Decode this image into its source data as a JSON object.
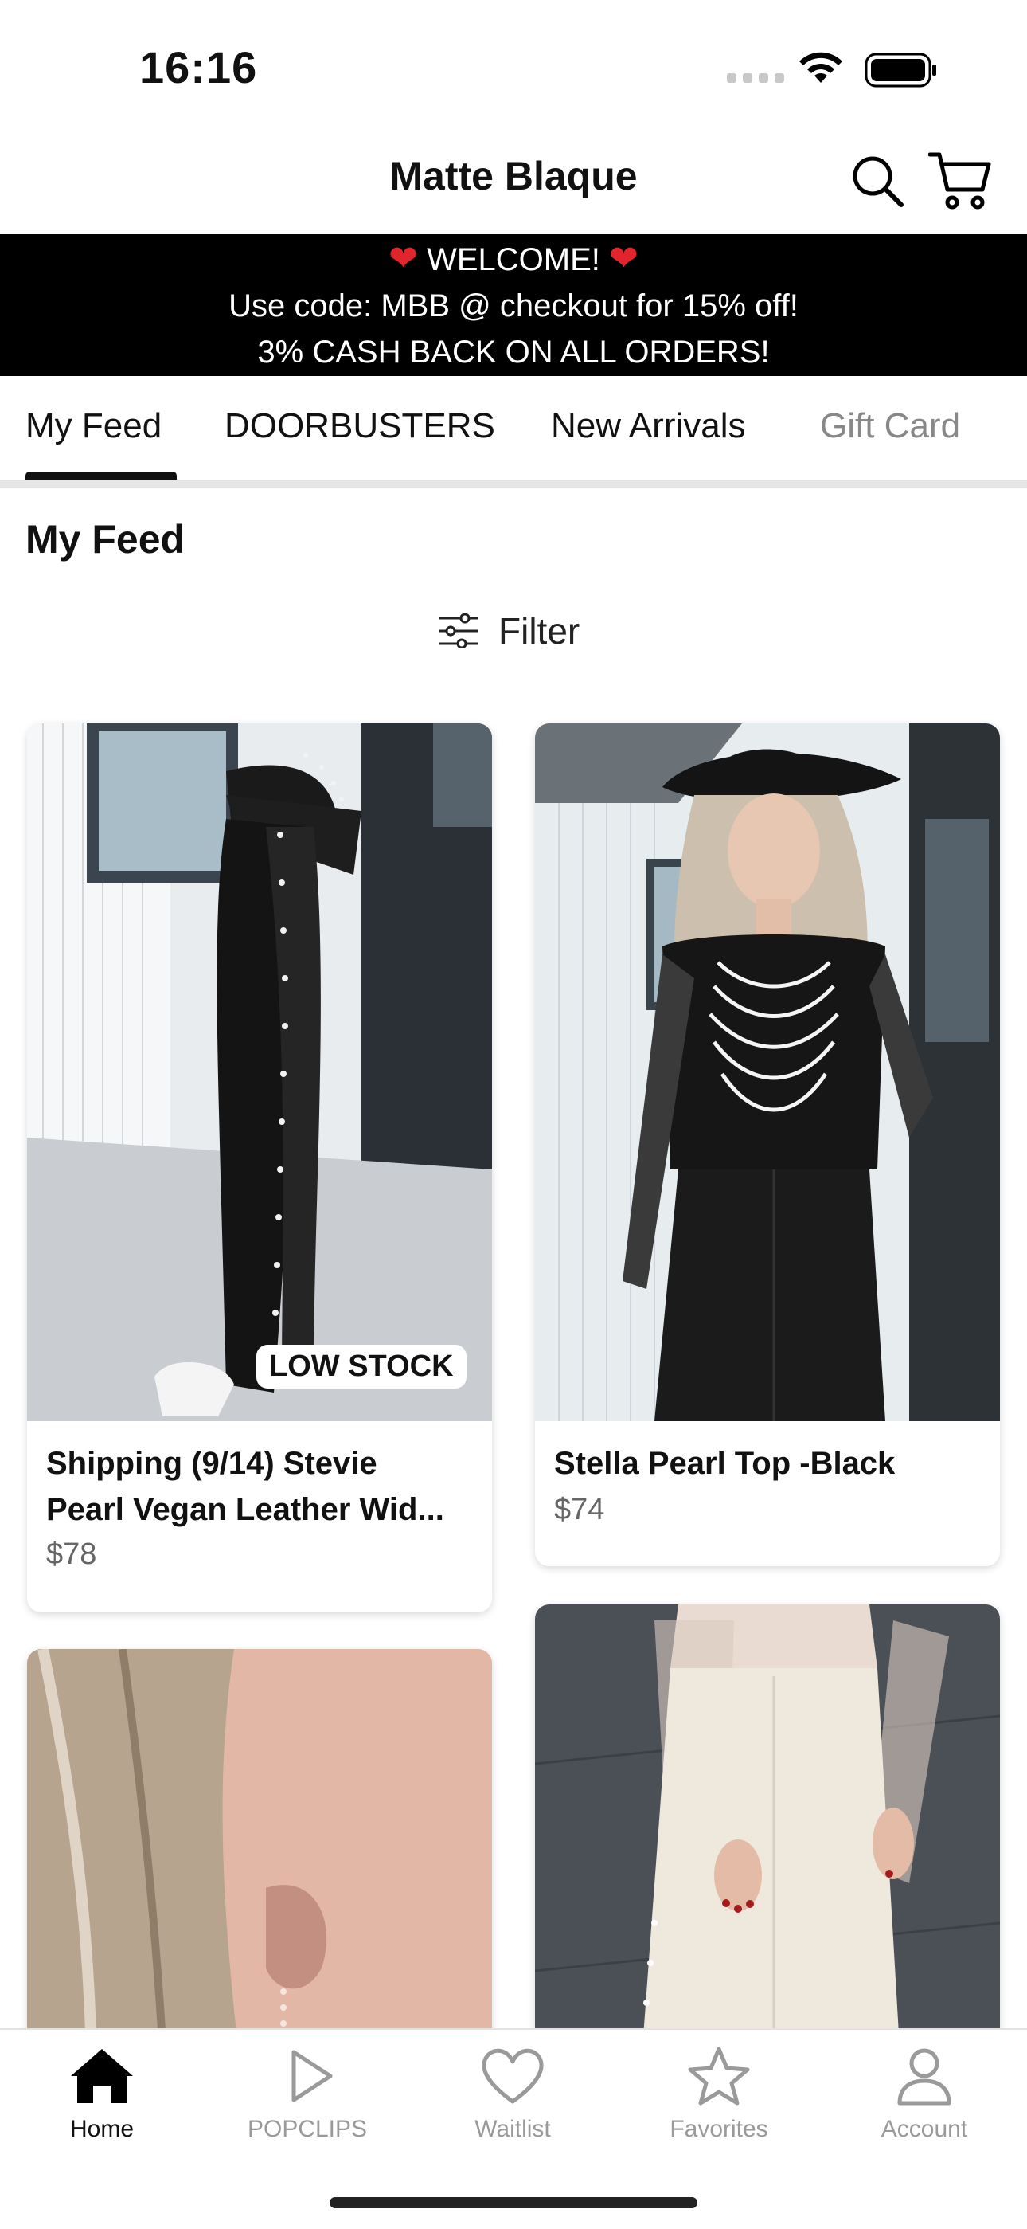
{
  "status_bar": {
    "time": "16:16"
  },
  "header": {
    "title": "Matte Blaque"
  },
  "promo": {
    "line1": "WELCOME!",
    "line2": "Use code: MBB @ checkout for 15% off!",
    "line3": "3% CASH BACK ON ALL ORDERS!"
  },
  "tabs": [
    {
      "label": "My Feed",
      "active": true
    },
    {
      "label": "DOORBUSTERS"
    },
    {
      "label": "New Arrivals"
    },
    {
      "label": "Gift Card"
    }
  ],
  "feed": {
    "title": "My Feed",
    "filter_label": "Filter",
    "products": [
      {
        "name_line1": "Shipping (9/14) Stevie",
        "name_line2": "Pearl Vegan Leather Wid...",
        "price": "$78",
        "badge": "LOW STOCK"
      },
      {
        "name_line1": "Stella Pearl Top -Black",
        "price": "$74"
      },
      {},
      {}
    ]
  },
  "bottom_nav": [
    {
      "label": "Home",
      "icon": "home-icon",
      "active": true
    },
    {
      "label": "POPCLIPS",
      "icon": "play-icon"
    },
    {
      "label": "Waitlist",
      "icon": "heart-icon"
    },
    {
      "label": "Favorites",
      "icon": "star-icon"
    },
    {
      "label": "Account",
      "icon": "person-icon"
    }
  ],
  "colors": {
    "accent": "#000000",
    "heart": "#e0252c",
    "inactive": "#9a9a9a"
  }
}
